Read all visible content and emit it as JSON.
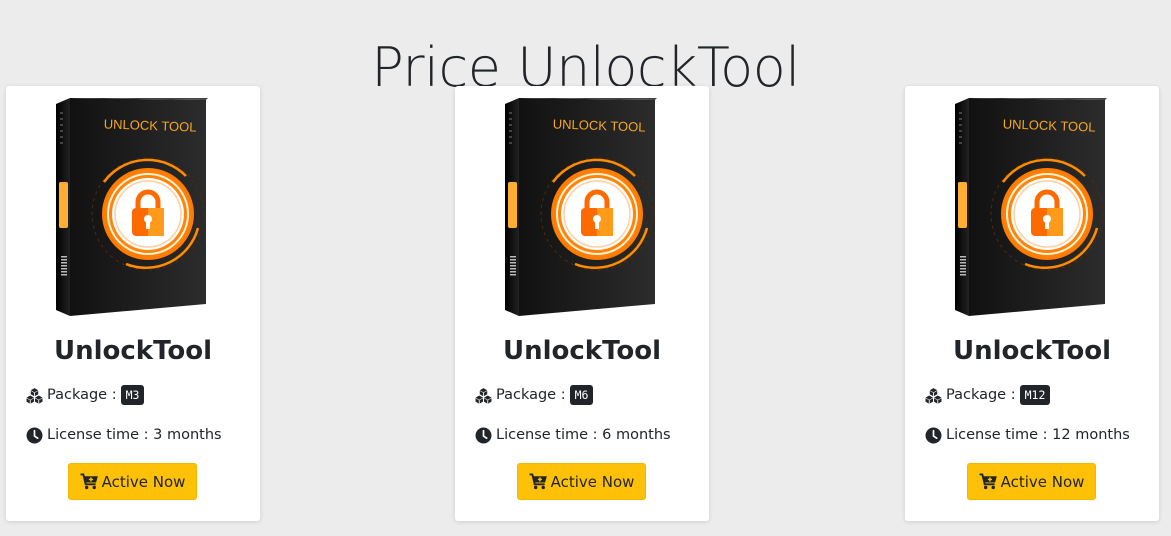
{
  "page": {
    "title": "Price UnlockTool"
  },
  "brand": {
    "accent": "#ffc107",
    "box_text": "UNLOCK TOOL"
  },
  "icons": {
    "package": "cubes-icon",
    "license": "clock-icon",
    "button": "cart-icon"
  },
  "cards": [
    {
      "title": "UnlockTool",
      "package_label": "Package :",
      "package_code": "M3",
      "license_text": "License time : 3 months",
      "button_label": "Active Now"
    },
    {
      "title": "UnlockTool",
      "package_label": "Package :",
      "package_code": "M6",
      "license_text": "License time : 6 months",
      "button_label": "Active Now"
    },
    {
      "title": "UnlockTool",
      "package_label": "Package :",
      "package_code": "M12",
      "license_text": "License time : 12 months",
      "button_label": "Active Now"
    }
  ]
}
